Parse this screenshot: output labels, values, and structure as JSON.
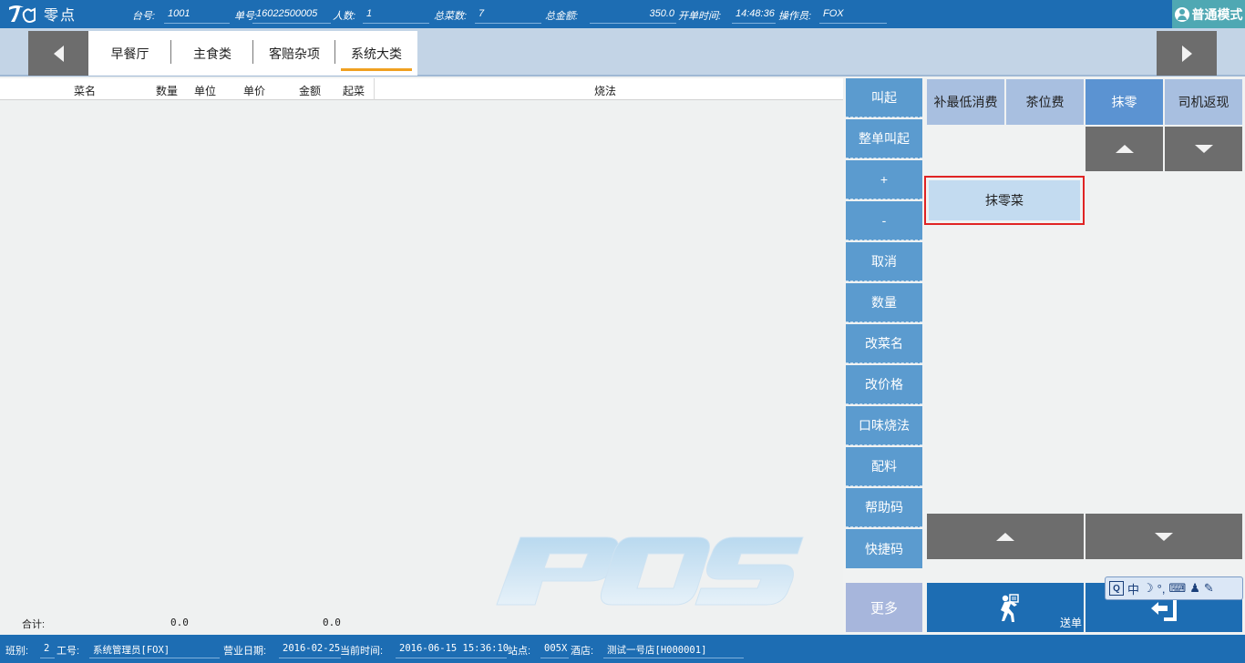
{
  "app": {
    "logo_text": "零点"
  },
  "topbar": {
    "table_label": "台号:",
    "table_value": "1001",
    "order_label": "单号:",
    "order_value": "16022500005",
    "guests_label": "人数:",
    "guests_value": "1",
    "dishes_label": "总菜数:",
    "dishes_value": "7",
    "amount_label": "总金额:",
    "amount_value": "350.0",
    "open_time_label": "开单时间:",
    "open_time_value": "14:48:36",
    "operator_label": "操作员:",
    "operator_value": "FOX",
    "mode_label": "普通模式"
  },
  "categories": {
    "tabs": [
      {
        "label": "早餐厅"
      },
      {
        "label": "主食类"
      },
      {
        "label": "客赔杂项"
      },
      {
        "label": "系统大类"
      }
    ],
    "active_index": 3
  },
  "order_table": {
    "columns": [
      "菜名",
      "数量",
      "单位",
      "单价",
      "金额",
      "起菜",
      "烧法"
    ],
    "rows": []
  },
  "totals": {
    "label": "合计:",
    "quantity": "0.0",
    "amount": "0.0"
  },
  "watermark": "POS",
  "functions": {
    "buttons": [
      {
        "label": "叫起"
      },
      {
        "label": "整单叫起"
      },
      {
        "label": "+"
      },
      {
        "label": "-"
      },
      {
        "label": "取消"
      },
      {
        "label": "数量"
      },
      {
        "label": "改菜名"
      },
      {
        "label": "改价格"
      },
      {
        "label": "口味烧法"
      },
      {
        "label": "配料"
      },
      {
        "label": "帮助码"
      },
      {
        "label": "快捷码"
      }
    ],
    "more_label": "更多"
  },
  "right_panel": {
    "categories": [
      {
        "label": "补最低消费"
      },
      {
        "label": "茶位费"
      },
      {
        "label": "抹零"
      },
      {
        "label": "司机返现"
      }
    ],
    "active_index": 2,
    "items": [
      {
        "label": "抹零菜"
      }
    ],
    "send_label": "送单"
  },
  "ime": {
    "mode": "中",
    "punct": "°,"
  },
  "status": {
    "shift_label": "班别:",
    "shift_value": "2",
    "staff_label": "工号:",
    "staff_value": "系统管理员[FOX]",
    "biz_date_label": "营业日期:",
    "biz_date_value": "2016-02-25",
    "now_label": "当前时间:",
    "now_value": "2016-06-15 15:36:10",
    "station_label": "站点:",
    "station_value": "005X",
    "store_label": "酒店:",
    "store_value": "测试一号店[H000001]"
  },
  "colors": {
    "primary": "#1d6db3",
    "function_button": "#5b9bcf",
    "category_button": "#a8bfe0",
    "category_active": "#5b93d2",
    "highlight_border": "#e02424",
    "accent_underline": "#f0a020"
  }
}
